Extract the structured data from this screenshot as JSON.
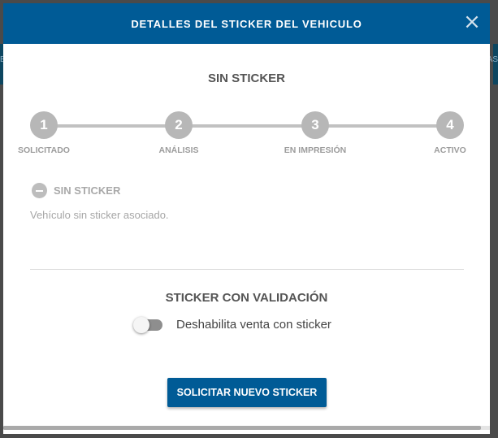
{
  "modal": {
    "title": "DETALLES DEL STICKER DEL VEHICULO",
    "close_label": "×"
  },
  "background": {
    "left_fragment": "E",
    "right_fragment": "AS"
  },
  "status": {
    "title": "SIN STICKER"
  },
  "steps": [
    {
      "number": "1",
      "label": "SOLICITADO"
    },
    {
      "number": "2",
      "label": "ANÁLISIS"
    },
    {
      "number": "3",
      "label": "EN IMPRESIÓN"
    },
    {
      "number": "4",
      "label": "ACTIVO"
    }
  ],
  "sticker_state": {
    "icon": "minus-circle-icon",
    "label": "SIN STICKER",
    "description": "Vehículo sin sticker asociado."
  },
  "validation": {
    "title": "STICKER CON VALIDACIÓN",
    "toggle_label": "Deshabilita venta con sticker",
    "toggle_on": false
  },
  "actions": {
    "request_button": "SOLICITAR NUEVO STICKER"
  },
  "colors": {
    "header": "#005b96",
    "step_inactive": "#b7b7b7",
    "primary_button": "#005b96"
  }
}
